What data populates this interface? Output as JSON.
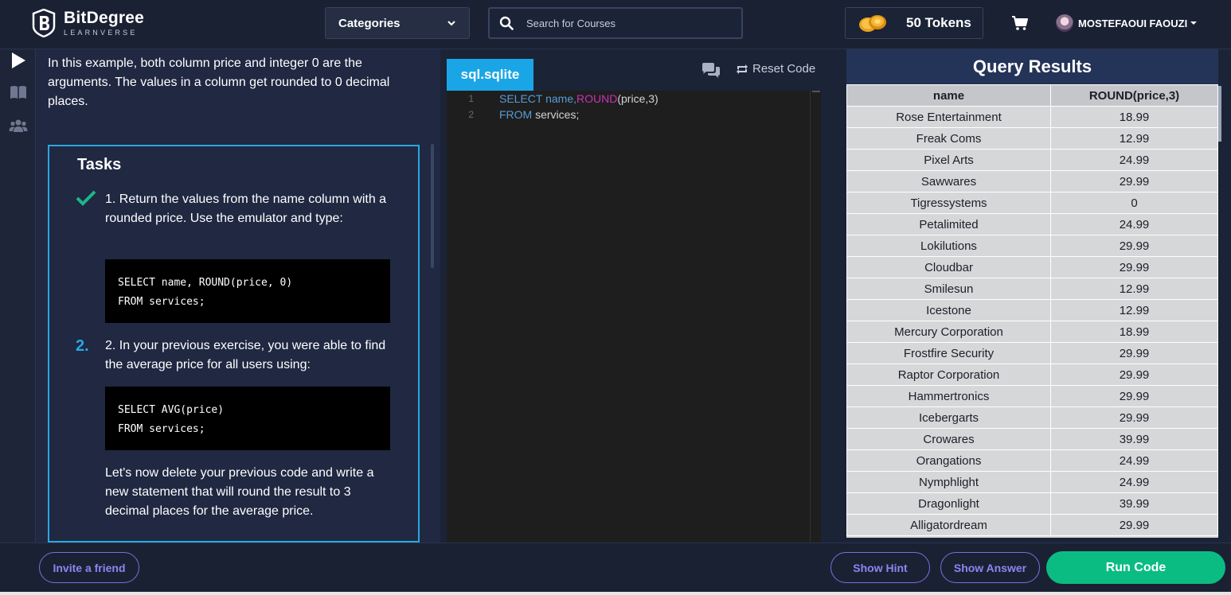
{
  "header": {
    "logo_name": "BitDegree",
    "logo_sub": "LEARNVERSE",
    "categories_label": "Categories",
    "search_placeholder": "Search for Courses",
    "tokens_label": "50 Tokens",
    "user_name": "MOSTEFAOUI FAOUZI"
  },
  "lesson": {
    "intro": "In this example, both column price and integer 0 are the arguments. The values in a column get rounded to 0 decimal places.",
    "tasks_title": "Tasks",
    "task1": {
      "text": "1. Return the values from the name column with a rounded price. Use the emulator and type:",
      "code": "SELECT name, ROUND(price, 0)\nFROM services;",
      "status": "completed"
    },
    "task2": {
      "marker": "2.",
      "text": "2. In your previous exercise, you were able to find the average price for all users using:",
      "code": "SELECT AVG(price)\nFROM services;",
      "followup": "Let's now delete your previous code and write a new statement that will round the result to 3 decimal places for the average price."
    }
  },
  "editor": {
    "tab_label": "sql.sqlite",
    "reset_label": "Reset Code",
    "lines": [
      {
        "num": "1",
        "kw": "SELECT name,",
        "fn": "ROUND",
        "rest": "(price,3)"
      },
      {
        "num": "2",
        "kw": "FROM",
        "fn": "",
        "rest": " services;"
      }
    ]
  },
  "results": {
    "title": "Query Results",
    "columns": [
      "name",
      "ROUND(price,3)"
    ],
    "rows": [
      [
        "Rose Entertainment",
        "18.99"
      ],
      [
        "Freak Coms",
        "12.99"
      ],
      [
        "Pixel Arts",
        "24.99"
      ],
      [
        "Sawwares",
        "29.99"
      ],
      [
        "Tigressystems",
        "0"
      ],
      [
        "Petalimited",
        "24.99"
      ],
      [
        "Lokilutions",
        "29.99"
      ],
      [
        "Cloudbar",
        "29.99"
      ],
      [
        "Smilesun",
        "12.99"
      ],
      [
        "Icestone",
        "12.99"
      ],
      [
        "Mercury Corporation",
        "18.99"
      ],
      [
        "Frostfire Security",
        "29.99"
      ],
      [
        "Raptor Corporation",
        "29.99"
      ],
      [
        "Hammertronics",
        "29.99"
      ],
      [
        "Icebergarts",
        "29.99"
      ],
      [
        "Crowares",
        "39.99"
      ],
      [
        "Orangations",
        "24.99"
      ],
      [
        "Nymphlight",
        "24.99"
      ],
      [
        "Dragonlight",
        "39.99"
      ],
      [
        "Alligatordream",
        "29.99"
      ]
    ]
  },
  "footer": {
    "invite_label": "Invite a friend",
    "hint_label": "Show Hint",
    "answer_label": "Show Answer",
    "run_label": "Run Code"
  },
  "colors": {
    "accent_blue": "#1aa6e6",
    "run_green": "#0bbc82",
    "outline_purple": "#7b6fe0",
    "check_green": "#1fb589"
  }
}
